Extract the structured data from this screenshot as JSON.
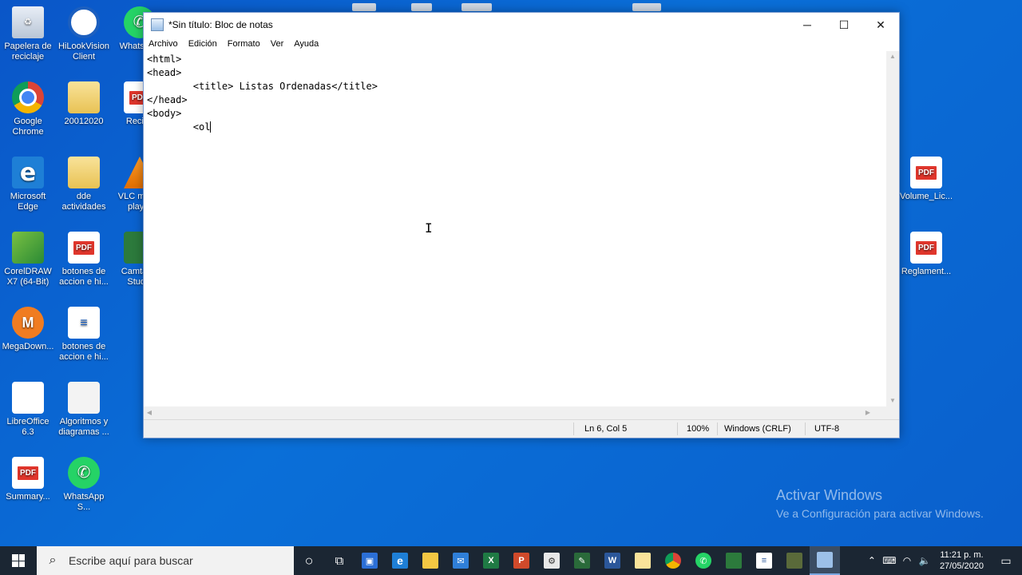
{
  "desktop": {
    "icons": [
      {
        "label": "Papelera de reciclaje",
        "icon": "recycle-bin-icon"
      },
      {
        "label": "HiLookVision Client",
        "icon": "hilookvision-icon"
      },
      {
        "label": "WhatsApp",
        "icon": "whatsapp-icon"
      },
      {
        "label": "Google Chrome",
        "icon": "chrome-icon"
      },
      {
        "label": "20012020",
        "icon": "folder-icon"
      },
      {
        "label": "Recibo",
        "icon": "pdf-icon"
      },
      {
        "label": "Microsoft Edge",
        "icon": "edge-icon"
      },
      {
        "label": "dde actividades",
        "icon": "folder-icon"
      },
      {
        "label": "VLC media player",
        "icon": "vlc-icon"
      },
      {
        "label": "CorelDRAW X7 (64-Bit)",
        "icon": "coreldraw-icon"
      },
      {
        "label": "botones de accion e hi...",
        "icon": "pdf-icon"
      },
      {
        "label": "Camtasia Studio",
        "icon": "camtasia-icon"
      },
      {
        "label": "MegaDown...",
        "icon": "megadownloader-icon"
      },
      {
        "label": "botones de accion e hi...",
        "icon": "document-icon"
      },
      {
        "label": "LibreOffice 6.3",
        "icon": "libreoffice-icon"
      },
      {
        "label": "Algoritmos y diagramas ...",
        "icon": "image-file-icon"
      },
      {
        "label": "Summary...",
        "icon": "pdf-icon"
      },
      {
        "label": "WhatsApp S...",
        "icon": "whatsapp-icon"
      },
      {
        "label": "Volume_Lic...",
        "icon": "pdf-icon"
      },
      {
        "label": "Reglament...",
        "icon": "pdf-icon"
      }
    ],
    "activate_title": "Activar Windows",
    "activate_subtitle": "Ve a Configuración para activar Windows."
  },
  "notepad": {
    "title": "*Sin título: Bloc de notas",
    "menu": [
      "Archivo",
      "Edición",
      "Formato",
      "Ver",
      "Ayuda"
    ],
    "content": "<html>\n<head>\n\t<title> Listas Ordenadas</title>\n</head>\n<body>\n\t<ol",
    "status": {
      "position": "Ln 6, Col 5",
      "zoom": "100%",
      "line_ending": "Windows (CRLF)",
      "encoding": "UTF-8"
    }
  },
  "taskbar": {
    "search_placeholder": "Escribe aquí para buscar",
    "apps": [
      "cortana-icon",
      "task-view-icon",
      "store-icon",
      "edge-icon",
      "file-explorer-icon",
      "mail-icon",
      "excel-icon",
      "powerpoint-icon",
      "settings-icon",
      "paint-icon",
      "word-icon",
      "folder-icon",
      "chrome-icon",
      "whatsapp-icon",
      "camtasia-icon",
      "notepad-doc-icon",
      "app-icon",
      "notepad-icon"
    ],
    "time": "11:21 p. m.",
    "date": "27/05/2020"
  }
}
